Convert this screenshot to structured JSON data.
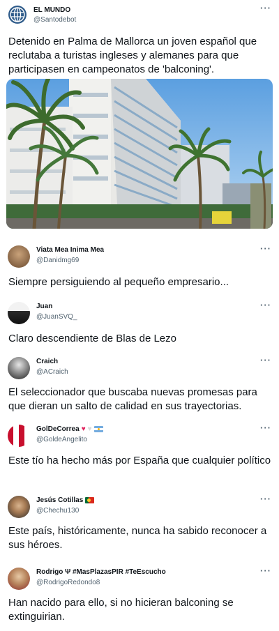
{
  "main_tweet": {
    "name": "EL MUNDO",
    "handle": "@Santodebot",
    "text": "Detenido en Palma de Mallorca un joven español que reclutaba a turistas ingleses y alemanes para que participasen en campeonatos de 'balconing'.",
    "more_label": "···",
    "avatar_icon": "globe-logo-icon",
    "photo_subject": "hotel-with-palm-trees"
  },
  "replies": [
    {
      "name": "Viata Mea Inima Mea",
      "handle": "@Danidmg69",
      "text": "Siempre persiguiendo al pequeño empresario...",
      "more_label": "···"
    },
    {
      "name": "Juan",
      "handle": "@JuanSVQ_",
      "text": "Claro descendiente de Blas de Lezo",
      "more_label": "···"
    },
    {
      "name": "Craich",
      "handle": "@ACraich",
      "text": "El seleccionador que buscaba nuevas promesas para que dieran un salto de calidad en sus trayectorias.",
      "more_label": "···"
    },
    {
      "name": "GolDeCorrea",
      "name_emoji": [
        "red-heart",
        "white-heart",
        "argentina-flag"
      ],
      "handle": "@GoldeAngelito",
      "text": "Este tío ha hecho más por España que cualquier político",
      "more_label": "···"
    },
    {
      "name": "Jesús Cotillas",
      "name_emoji": [
        "portugal-flag"
      ],
      "handle": "@Chechu130",
      "text": "Este país, históricamente, nunca ha sabido reconocer a sus héroes.",
      "more_label": "···"
    },
    {
      "name": "Rodrigo Ψ #MasPlazasPIR #TeEscucho",
      "handle": "@RodrigoRedondo8",
      "text": "Han nacido para ello, si no hicieran balconing se extinguirian.",
      "more_label": "···"
    }
  ],
  "colors": {
    "text": "#0f1419",
    "secondary": "#536471",
    "sky": "#7fb6e8"
  }
}
